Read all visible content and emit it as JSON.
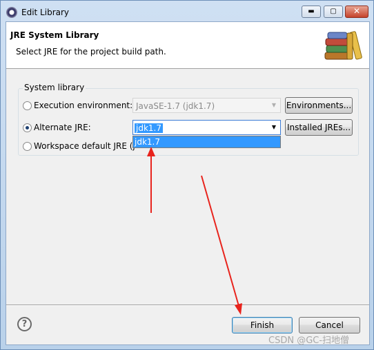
{
  "window": {
    "title": "Edit Library",
    "controls": {
      "minimize": "▬",
      "maximize": "▢",
      "close": "✕"
    }
  },
  "header": {
    "title": "JRE System Library",
    "description": "Select JRE for the project build path.",
    "icon": "library-books-icon"
  },
  "group": {
    "label": "System library",
    "execution_env": {
      "label": "Execution environment:",
      "checked": false,
      "value": "JavaSE-1.7 (jdk1.7)",
      "button": "Environments..."
    },
    "alternate_jre": {
      "label": "Alternate JRE:",
      "checked": true,
      "value": "jdk1.7",
      "button": "Installed JREs..."
    },
    "workspace_default": {
      "label": "Workspace default JRE (j",
      "checked": false
    },
    "dropdown_options": [
      "jdk1.7"
    ]
  },
  "footer": {
    "help_icon": "help-question-icon",
    "help_glyph": "?",
    "finish": "Finish",
    "cancel": "Cancel"
  },
  "watermark": "CSDN @GC-扫地僧",
  "colors": {
    "annotation_arrow": "#e8231c",
    "selection": "#3399ff"
  }
}
